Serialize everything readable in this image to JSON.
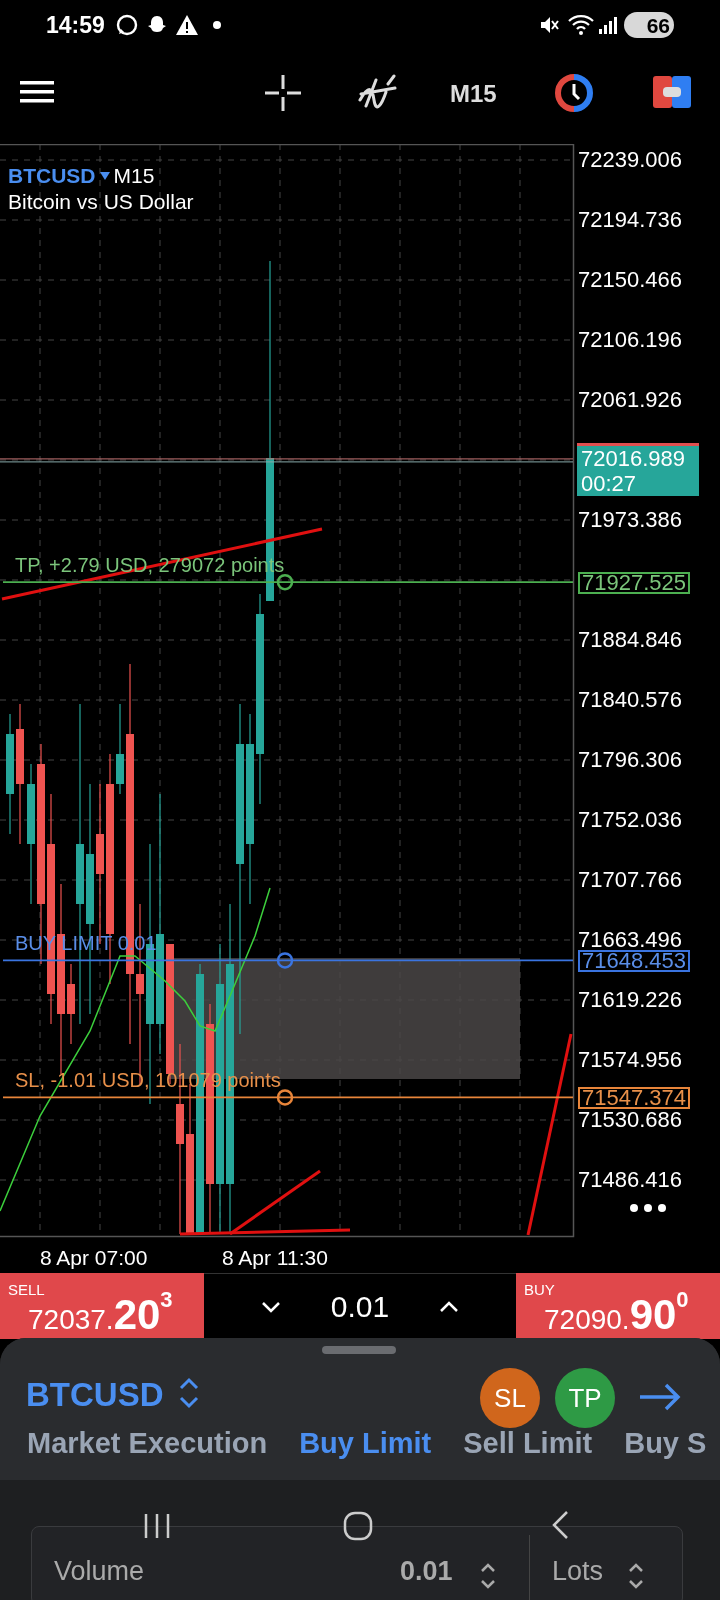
{
  "status_bar": {
    "time": "14:59",
    "battery": "66"
  },
  "toolbar": {
    "timeframe": "M15"
  },
  "chart": {
    "symbol": "BTCUSD",
    "timeframe": "M15",
    "description": "Bitcoin vs US Dollar",
    "price_axis": [
      "72239.006",
      "72194.736",
      "72150.466",
      "72106.196",
      "72061.926",
      "71973.386",
      "71884.846",
      "71840.576",
      "71796.306",
      "71752.036",
      "71707.766",
      "71663.496",
      "71619.226",
      "71574.956",
      "71530.686",
      "71486.416"
    ],
    "price_lines": [
      {
        "kind": "current",
        "price": "72016.989",
        "timer": "00:27"
      },
      {
        "kind": "tp",
        "label": "TP, +2.79 USD, 279072 points",
        "price": "71927.525"
      },
      {
        "kind": "buy_limit",
        "label": "BUY LIMIT 0.01",
        "price": "71648.453"
      },
      {
        "kind": "sl",
        "label": "SL, -1.01 USD, 101079 points",
        "price": "71547.374"
      }
    ],
    "time_axis": [
      "8 Apr 07:00",
      "8 Apr 11:30"
    ]
  },
  "trade_bar": {
    "sell": {
      "label": "SELL",
      "price": "72037.",
      "big": "20",
      "sup": "3"
    },
    "volume": "0.01",
    "buy": {
      "label": "BUY",
      "price": "72090.",
      "big": "90",
      "sup": "0"
    }
  },
  "order_sheet": {
    "symbol": "BTCUSD",
    "sl": "SL",
    "tp": "TP",
    "tabs": [
      {
        "label": "Market Execution",
        "selected": false
      },
      {
        "label": "Buy Limit",
        "selected": true
      },
      {
        "label": "Sell Limit",
        "selected": false
      },
      {
        "label": "Buy S",
        "selected": false
      }
    ],
    "volume_field": {
      "label": "Volume",
      "value": "0.01",
      "unit": "Lots"
    }
  }
}
